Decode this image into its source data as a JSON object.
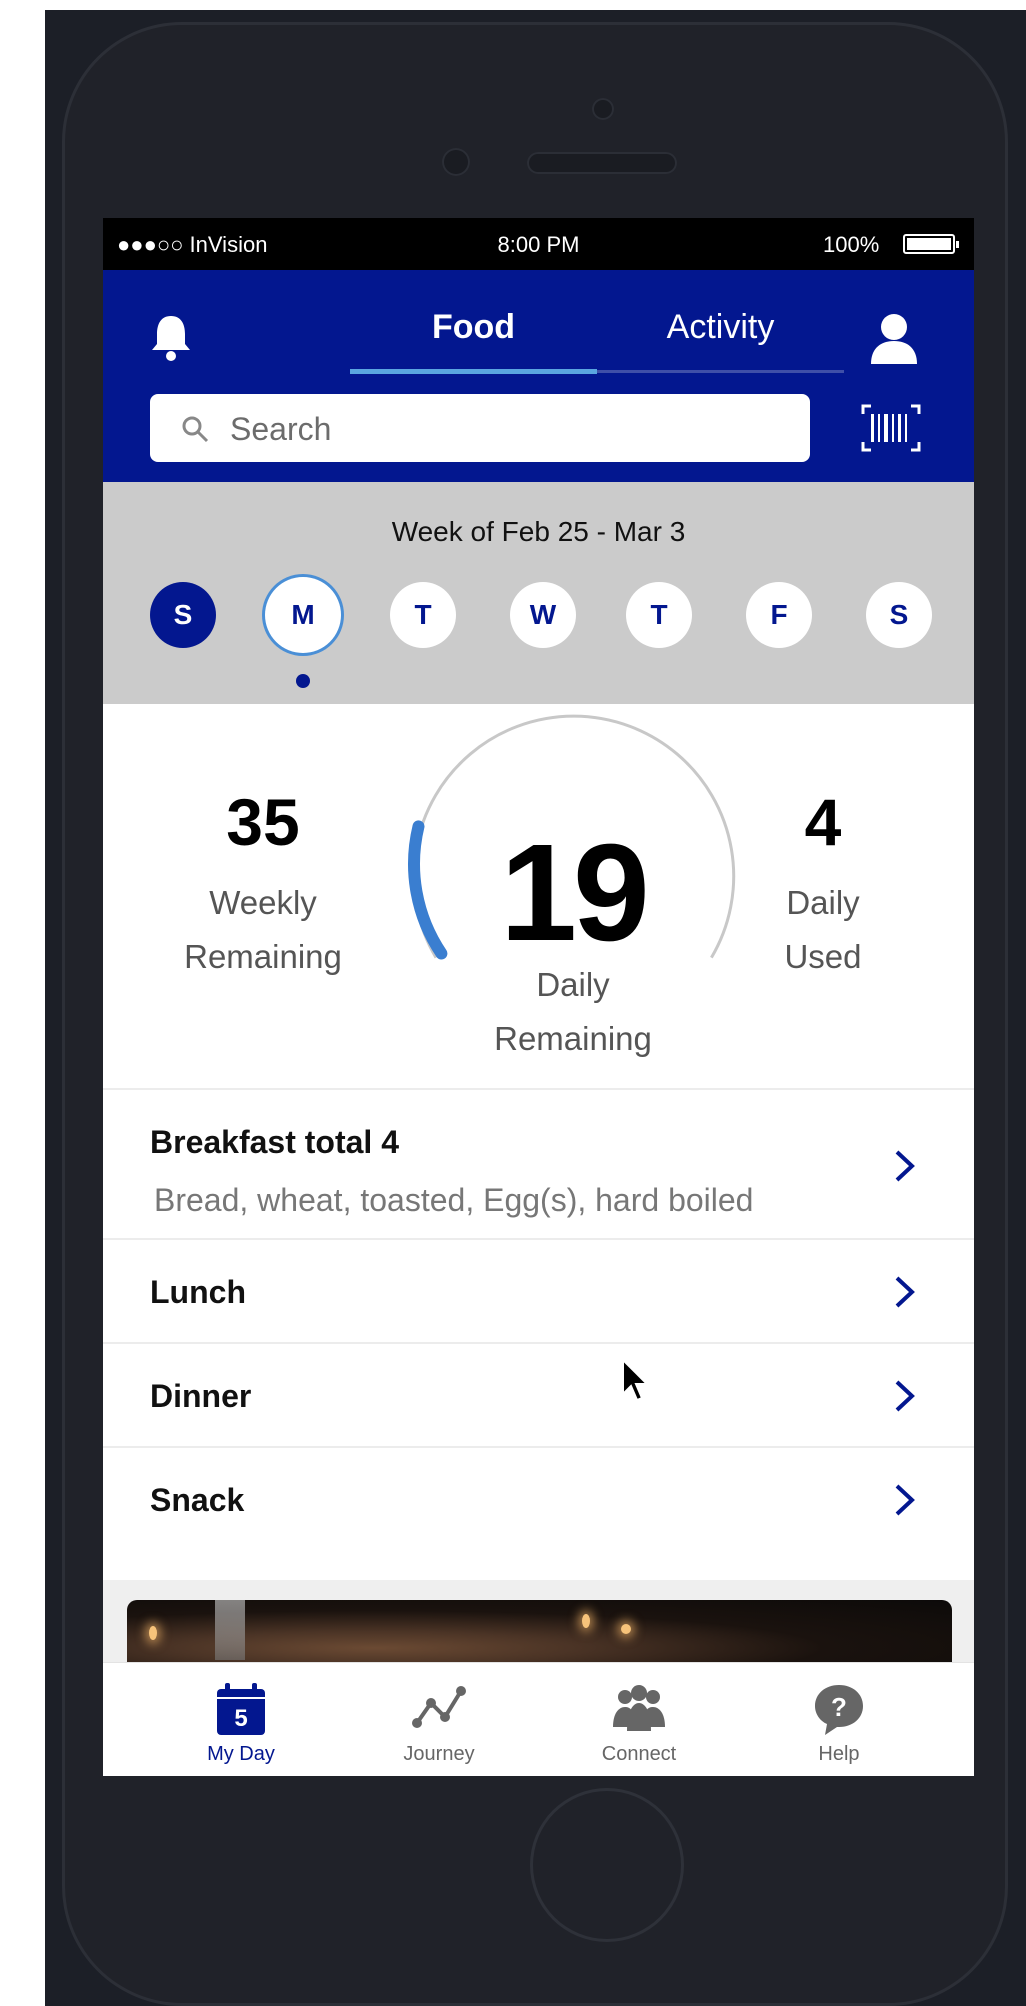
{
  "status_bar": {
    "carrier": "●●●○○ InVision",
    "time": "8:00 PM",
    "battery": "100%"
  },
  "header": {
    "tabs": [
      {
        "label": "Food",
        "active": true
      },
      {
        "label": "Activity",
        "active": false
      }
    ],
    "search": {
      "placeholder": "Search"
    }
  },
  "week": {
    "title": "Week of Feb 25 - Mar 3",
    "days": [
      {
        "label": "S",
        "state": "filled"
      },
      {
        "label": "M",
        "state": "selected"
      },
      {
        "label": "T",
        "state": "default"
      },
      {
        "label": "W",
        "state": "default"
      },
      {
        "label": "T",
        "state": "default"
      },
      {
        "label": "F",
        "state": "default"
      },
      {
        "label": "S",
        "state": "default"
      }
    ]
  },
  "summary": {
    "weekly": {
      "value": "35",
      "label_1": "Weekly",
      "label_2": "Remaining"
    },
    "daily_remaining": {
      "value": "19",
      "label_1": "Daily",
      "label_2": "Remaining"
    },
    "daily_used": {
      "value": "4",
      "label_1": "Daily",
      "label_2": "Used"
    },
    "gauge_used_fraction": 0.17
  },
  "meals": [
    {
      "title": "Breakfast total 4",
      "items": "Bread, wheat, toasted, Egg(s), hard boiled"
    },
    {
      "title": "Lunch"
    },
    {
      "title": "Dinner"
    },
    {
      "title": "Snack"
    }
  ],
  "nav": [
    {
      "label": "My Day",
      "badge": "5",
      "icon": "calendar-icon",
      "active": true
    },
    {
      "label": "Journey",
      "icon": "journey-graph-icon",
      "active": false
    },
    {
      "label": "Connect",
      "icon": "people-icon",
      "active": false
    },
    {
      "label": "Help",
      "icon": "help-bubble-icon",
      "active": false
    }
  ],
  "colors": {
    "brand": "#03178f",
    "accent": "#4a8fd6",
    "week_bg": "#cbcbcb"
  }
}
